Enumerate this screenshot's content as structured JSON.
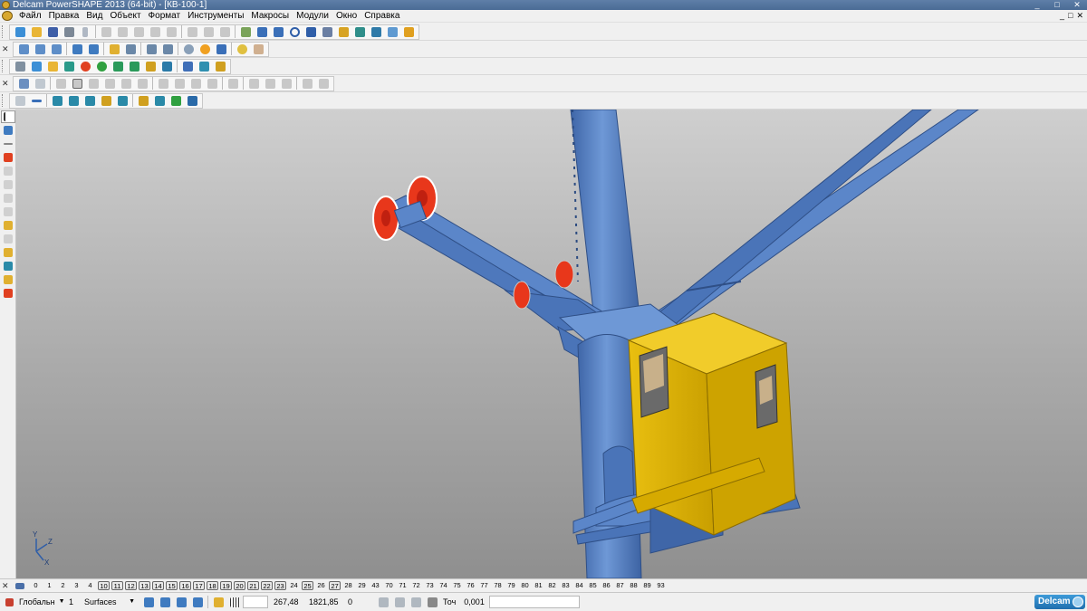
{
  "window": {
    "title": "Delcam PowerSHAPE 2013 (64-bit) - [КВ-100-1]",
    "buttons": [
      "_",
      "□",
      "✕"
    ]
  },
  "menu": {
    "items": [
      "Файл",
      "Правка",
      "Вид",
      "Объект",
      "Формат",
      "Инструменты",
      "Макросы",
      "Модули",
      "Окно",
      "Справка"
    ],
    "mdi_buttons": [
      "_",
      "□",
      "✕"
    ]
  },
  "toolbars": {
    "main_close": "✕",
    "row2_close": "✕",
    "row3_close": "✕"
  },
  "viewport": {
    "axis_labels": {
      "y": "Y",
      "z": "Z",
      "x": "X"
    },
    "colors": {
      "steel": "#5b86c9",
      "steel_dark": "#3f66a8",
      "cab": "#e1b400",
      "cab_dark": "#b58e00",
      "flange": "#e8371b"
    }
  },
  "levels": [
    "0",
    "1",
    "2",
    "3",
    "4",
    "10",
    "11",
    "12",
    "13",
    "14",
    "15",
    "16",
    "17",
    "18",
    "19",
    "20",
    "21",
    "22",
    "23",
    "24",
    "25",
    "26",
    "27",
    "28",
    "29",
    "43",
    "70",
    "71",
    "72",
    "73",
    "74",
    "75",
    "76",
    "77",
    "78",
    "79",
    "80",
    "81",
    "82",
    "83",
    "84",
    "85",
    "86",
    "87",
    "88",
    "89",
    "93"
  ],
  "boxed_levels": [
    "10",
    "11",
    "12",
    "13",
    "14",
    "15",
    "16",
    "17",
    "18",
    "19",
    "20",
    "21",
    "22",
    "23",
    "25",
    "27"
  ],
  "status": {
    "workplane": "Глобальн",
    "level_number": "1",
    "level_name": "Surfaces",
    "x_coord": "267,48",
    "y_coord": "1821,85",
    "z_coord": "0",
    "tolerance_label": "Точ",
    "tolerance_value": "0,001",
    "logo": "Delcam"
  }
}
